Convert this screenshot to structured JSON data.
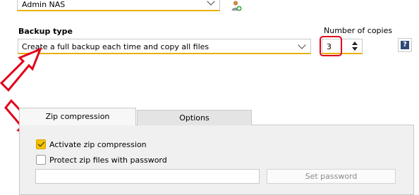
{
  "destination": {
    "selected": "Admin NAS"
  },
  "backup_type": {
    "label": "Backup type",
    "selected": "Create a full backup each time and copy all files"
  },
  "copies": {
    "label": "Number of copies",
    "value": "3"
  },
  "help": {
    "glyph": "?"
  },
  "tabs": [
    {
      "label": "Zip compression",
      "active": true
    },
    {
      "label": "Options",
      "active": false
    }
  ],
  "zip": {
    "activate_label": "Activate zip compression",
    "activate_checked": true,
    "protect_label": "Protect zip files with password",
    "protect_checked": false,
    "password_value": "",
    "set_password_label": "Set password"
  },
  "colors": {
    "accent": "#e8b100",
    "annotation_red": "#e2001a",
    "help_blue": "#2f4a77"
  },
  "icons": {
    "user": "user-add-icon",
    "arrows": [
      "annotation-arrow-icon",
      "annotation-arrow-icon"
    ]
  }
}
